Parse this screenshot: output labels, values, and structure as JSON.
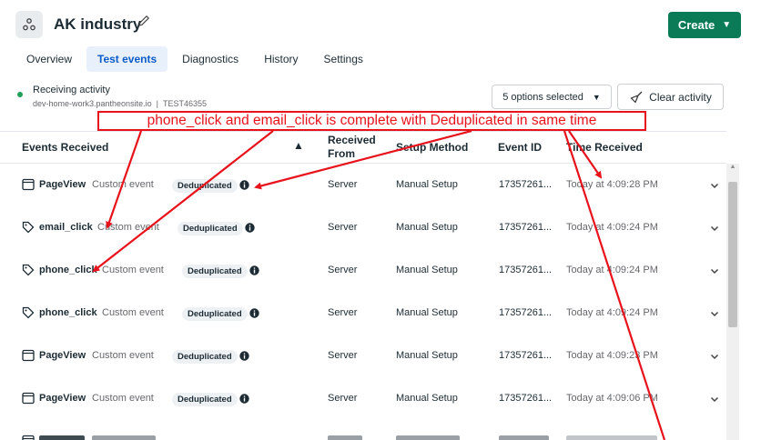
{
  "header": {
    "title": "AK industry",
    "create_label": "Create"
  },
  "tabs": [
    {
      "label": "Overview",
      "active": false
    },
    {
      "label": "Test events",
      "active": true
    },
    {
      "label": "Diagnostics",
      "active": false
    },
    {
      "label": "History",
      "active": false
    },
    {
      "label": "Settings",
      "active": false
    }
  ],
  "activity": {
    "status": "Receiving activity",
    "domain": "dev-home-work3.pantheonsite.io",
    "separator": "|",
    "test_code": "TEST46355"
  },
  "controls": {
    "options_label": "5 options selected",
    "clear_label": "Clear activity"
  },
  "annotation": {
    "text": "phone_click and email_click is complete with Deduplicated in same time",
    "color": "#e8121b"
  },
  "table": {
    "headers": {
      "events": "Events Received",
      "received_from": "Received From",
      "setup": "Setup Method",
      "event_id": "Event ID",
      "time": "Time Received"
    },
    "rows": [
      {
        "icon": "page-icon",
        "name": "PageView",
        "type": "Custom event",
        "badge": "Deduplicated",
        "from": "Server",
        "setup": "Manual Setup",
        "id": "17357261...",
        "time": "Today at 4:09:28 PM"
      },
      {
        "icon": "tag-icon",
        "name": "email_click",
        "type": "Custom event",
        "badge": "Deduplicated",
        "from": "Server",
        "setup": "Manual Setup",
        "id": "17357261...",
        "time": "Today at 4:09:24 PM"
      },
      {
        "icon": "tag-icon",
        "name": "phone_click",
        "type": "Custom event",
        "badge": "Deduplicated",
        "from": "Server",
        "setup": "Manual Setup",
        "id": "17357261...",
        "time": "Today at 4:09:24 PM"
      },
      {
        "icon": "tag-icon",
        "name": "phone_click",
        "type": "Custom event",
        "badge": "Deduplicated",
        "from": "Server",
        "setup": "Manual Setup",
        "id": "17357261...",
        "time": "Today at 4:09:24 PM"
      },
      {
        "icon": "page-icon",
        "name": "PageView",
        "type": "Custom event",
        "badge": "Deduplicated",
        "from": "Server",
        "setup": "Manual Setup",
        "id": "17357261...",
        "time": "Today at 4:09:23 PM"
      },
      {
        "icon": "page-icon",
        "name": "PageView",
        "type": "Custom event",
        "badge": "Deduplicated",
        "from": "Server",
        "setup": "Manual Setup",
        "id": "17357261...",
        "time": "Today at 4:09:06 PM"
      }
    ]
  }
}
